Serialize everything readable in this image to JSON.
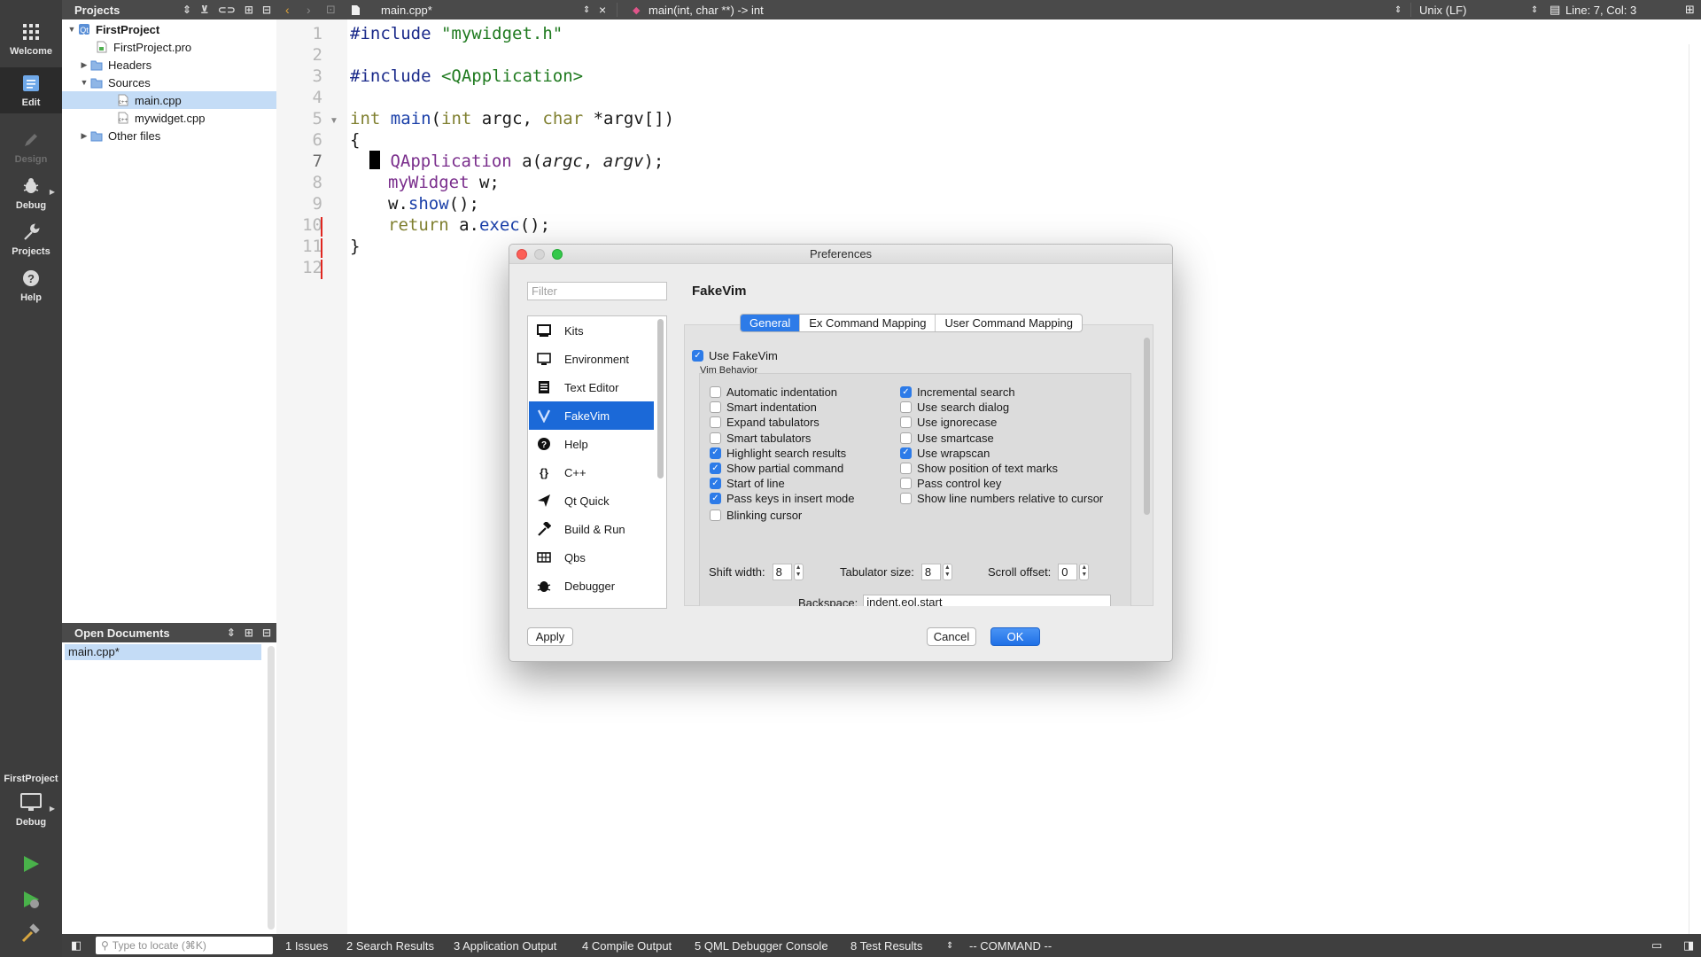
{
  "modes": {
    "welcome": "Welcome",
    "edit": "Edit",
    "design": "Design",
    "debug": "Debug",
    "projects": "Projects",
    "help": "Help",
    "kit_project": "FirstProject",
    "kit_config": "Debug"
  },
  "projects_panel": {
    "title": "Projects",
    "tree": [
      {
        "label": "FirstProject",
        "bold": true
      },
      {
        "label": "FirstProject.pro"
      },
      {
        "label": "Headers"
      },
      {
        "label": "Sources"
      },
      {
        "label": "main.cpp",
        "selected": true
      },
      {
        "label": "mywidget.cpp"
      },
      {
        "label": "Other files"
      }
    ]
  },
  "open_documents": {
    "title": "Open Documents",
    "docs": [
      "main.cpp*"
    ]
  },
  "toolbar": {
    "file": "main.cpp*",
    "symbol": "main(int, char **) -> int",
    "line_ending": "Unix (LF)",
    "position": "Line: 7, Col: 3"
  },
  "editor": {
    "line_numbers": [
      "1",
      "2",
      "3",
      "4",
      "5",
      "6",
      "7",
      "8",
      "9",
      "10",
      "11",
      "12"
    ],
    "current_line": 7
  },
  "statusbar": {
    "locate_placeholder": "Type to locate (⌘K)",
    "panes": [
      "1  Issues",
      "2  Search Results",
      "3  Application Output",
      "4  Compile Output",
      "5  QML Debugger Console",
      "8  Test Results"
    ],
    "mode": "-- COMMAND --"
  },
  "dialog": {
    "title": "Preferences",
    "filter_placeholder": "Filter",
    "categories": [
      "Kits",
      "Environment",
      "Text Editor",
      "FakeVim",
      "Help",
      "C++",
      "Qt Quick",
      "Build & Run",
      "Qbs",
      "Debugger"
    ],
    "selected_category": "FakeVim",
    "page_title": "FakeVim",
    "tabs": [
      "General",
      "Ex Command Mapping",
      "User Command Mapping"
    ],
    "use_fakevim": "Use FakeVim",
    "vim_behavior": "Vim Behavior",
    "left_options": [
      {
        "label": "Automatic indentation",
        "checked": false
      },
      {
        "label": "Smart indentation",
        "checked": false
      },
      {
        "label": "Expand tabulators",
        "checked": false
      },
      {
        "label": "Smart tabulators",
        "checked": false
      },
      {
        "label": "Highlight search results",
        "checked": true
      },
      {
        "label": "Show partial command",
        "checked": true
      },
      {
        "label": "Start of line",
        "checked": true
      },
      {
        "label": "Pass keys in insert mode",
        "checked": true
      },
      {
        "label": "Blinking cursor",
        "checked": false
      }
    ],
    "right_options": [
      {
        "label": "Incremental search",
        "checked": true
      },
      {
        "label": "Use search dialog",
        "checked": false
      },
      {
        "label": "Use ignorecase",
        "checked": false
      },
      {
        "label": "Use smartcase",
        "checked": false
      },
      {
        "label": "Use wrapscan",
        "checked": true
      },
      {
        "label": "Show position of text marks",
        "checked": false
      },
      {
        "label": "Pass control key",
        "checked": false
      },
      {
        "label": "Show line numbers relative to cursor",
        "checked": false
      }
    ],
    "shift_width_label": "Shift width:",
    "shift_width": "8",
    "tab_size_label": "Tabulator size:",
    "tab_size": "8",
    "scroll_offset_label": "Scroll offset:",
    "scroll_offset": "0",
    "backspace_label": "Backspace:",
    "backspace_value": "indent,eol,start",
    "apply": "Apply",
    "cancel": "Cancel",
    "ok": "OK"
  },
  "colors": {
    "selection_blue": "#1b69d8",
    "tree_selection": "#c4dcf6",
    "sidebar": "#3d3d3d",
    "modified_marker": "#e0261f"
  }
}
